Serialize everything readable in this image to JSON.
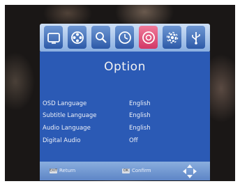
{
  "toolbar": {
    "tabs": [
      {
        "icon": "tv-icon"
      },
      {
        "icon": "film-reel-icon"
      },
      {
        "icon": "search-channel-icon"
      },
      {
        "icon": "clock-icon"
      },
      {
        "icon": "option-icon",
        "active": true
      },
      {
        "icon": "settings-gear-icon"
      },
      {
        "icon": "usb-icon"
      }
    ]
  },
  "panel": {
    "title": "Option",
    "rows": [
      {
        "label": "OSD Language",
        "value": "English"
      },
      {
        "label": "Subtitle Language",
        "value": "English"
      },
      {
        "label": "Audio Language",
        "value": "English"
      },
      {
        "label": "Digital Audio",
        "value": "Off"
      }
    ]
  },
  "footer": {
    "return_key": "EXIT",
    "return_label": "Return",
    "confirm_key": "OK",
    "confirm_label": "Confirm",
    "nav_icon": "dpad-arrows-icon"
  },
  "colors": {
    "panel": "#2b5ab5",
    "tab": "#3b68b8",
    "tab_active": "#e2456f",
    "toolbar": "#a9c4ea"
  }
}
